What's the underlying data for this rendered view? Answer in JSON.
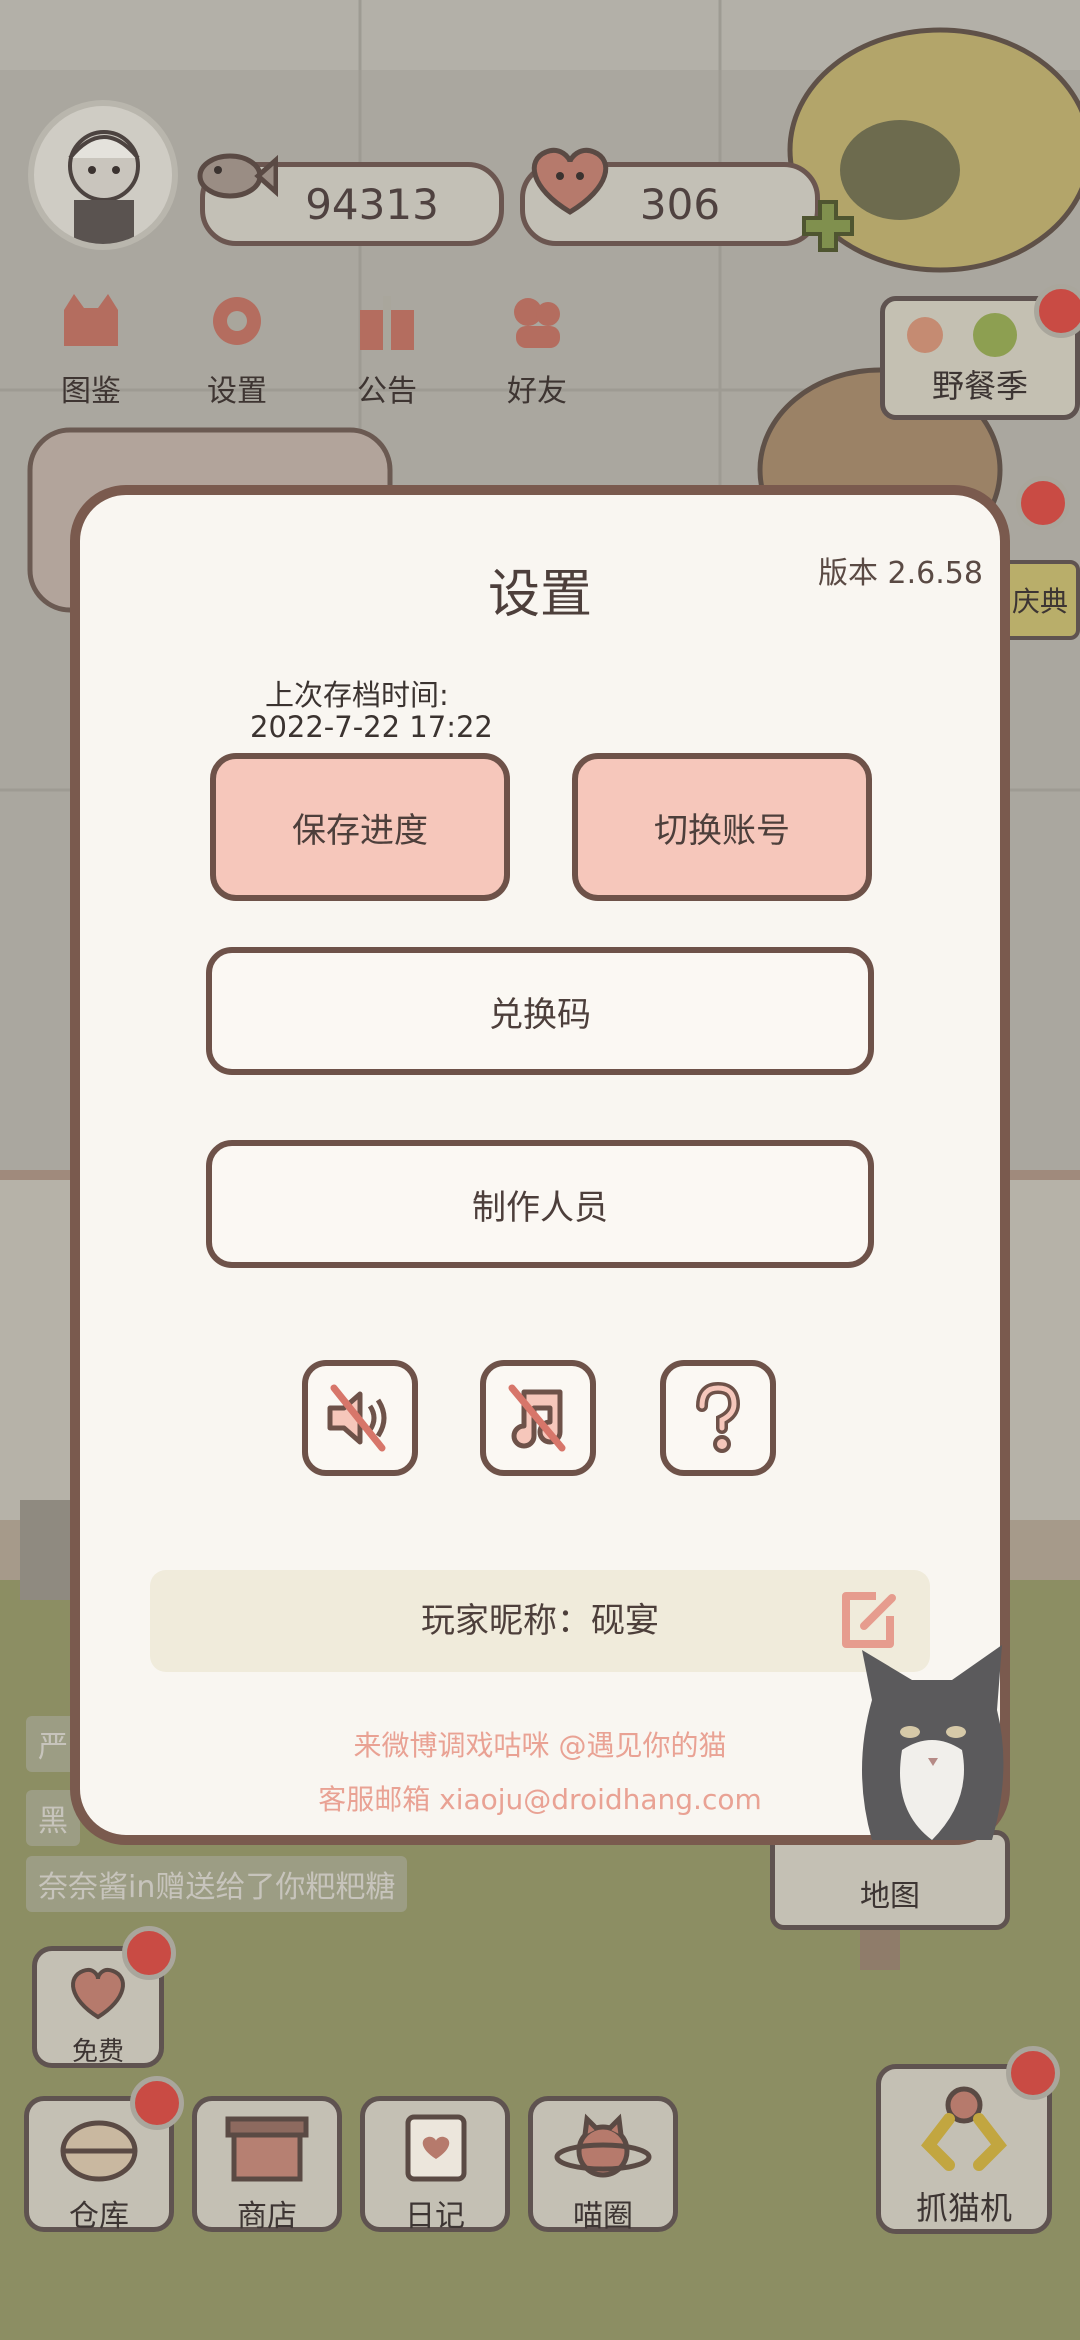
{
  "hud": {
    "fish_count": "94313",
    "heart_count": "306"
  },
  "top_menu": [
    {
      "label": "图鉴",
      "icon": "cat-book-icon"
    },
    {
      "label": "设置",
      "icon": "gear-icon"
    },
    {
      "label": "公告",
      "icon": "gift-icon"
    },
    {
      "label": "好友",
      "icon": "friends-icon"
    }
  ],
  "event_badge": {
    "label": "野餐季"
  },
  "side_badge": {
    "label": "庆典"
  },
  "dialog": {
    "title": "设置",
    "version": "版本 2.6.58",
    "last_save_label": "上次存档时间:",
    "last_save_time": "2022-7-22 17:22",
    "save_button": "保存进度",
    "switch_account_button": "切换账号",
    "redeem_code_button": "兑换码",
    "credits_button": "制作人员",
    "sound_icon": "sound-muted-icon",
    "music_icon": "music-muted-icon",
    "help_icon": "help-icon",
    "nickname": "玩家昵称：砚宴",
    "weibo_text": "来微博调戏咕咪 @遇见你的猫",
    "email_text": "客服邮箱 xiaoju@droidhang.com",
    "link_color": "#e9a294"
  },
  "feed": {
    "line1": "严",
    "line2": "黑",
    "line3": "奈奈酱in赠送给了你粑粑糖"
  },
  "map_label": "地图",
  "bottom_bar": {
    "free": "免费",
    "warehouse": "仓库",
    "shop": "商店",
    "diary": "日记",
    "cat_circle": "喵圈",
    "claw_machine": "抓猫机"
  },
  "colors": {
    "dialog_bg": "#f9f6f1",
    "dialog_border": "#7a5a4e",
    "button_pink": "#f6c7bb",
    "badge_red": "#c94b44"
  }
}
